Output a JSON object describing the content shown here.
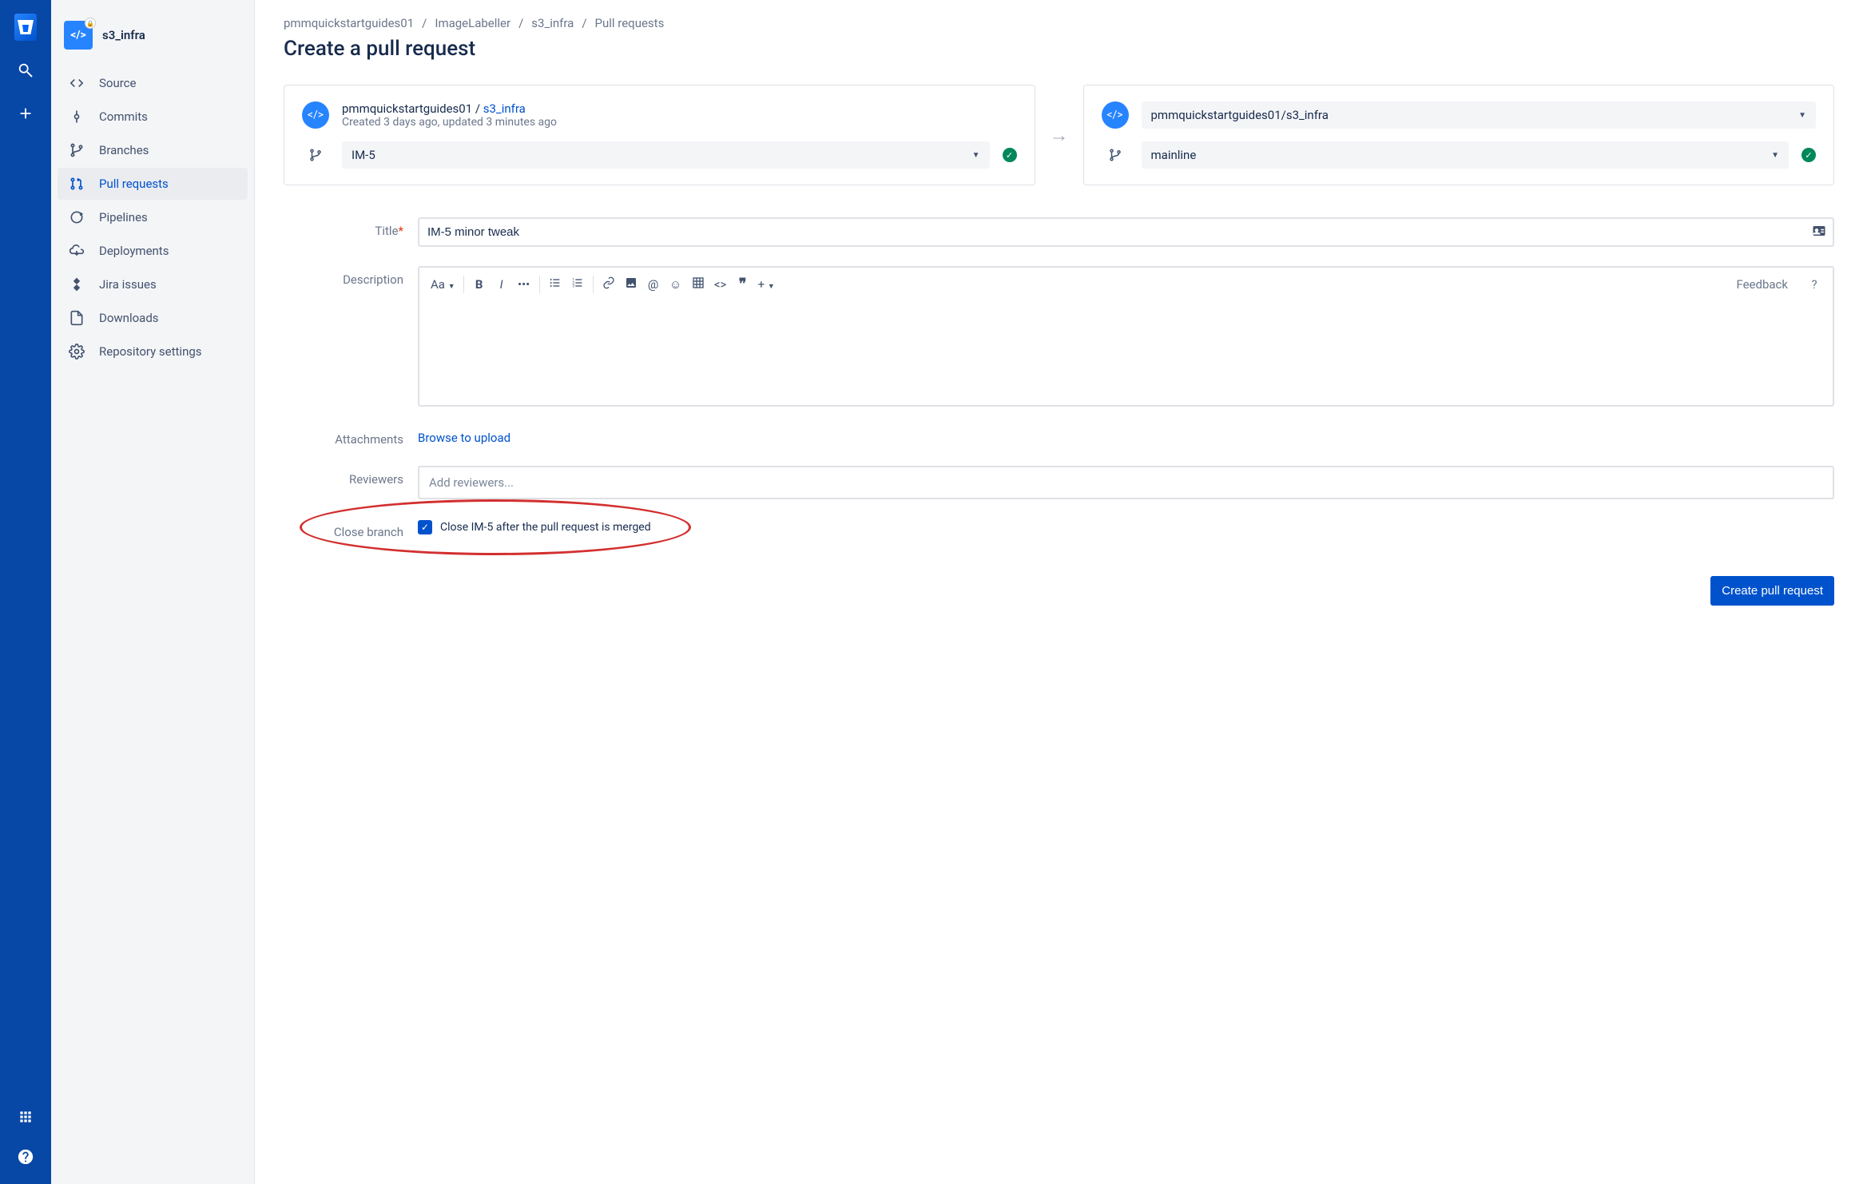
{
  "repo": {
    "name": "s3_infra"
  },
  "sidebar": {
    "items": [
      {
        "id": "source",
        "label": "Source"
      },
      {
        "id": "commits",
        "label": "Commits"
      },
      {
        "id": "branches",
        "label": "Branches"
      },
      {
        "id": "pull-requests",
        "label": "Pull requests"
      },
      {
        "id": "pipelines",
        "label": "Pipelines"
      },
      {
        "id": "deployments",
        "label": "Deployments"
      },
      {
        "id": "jira-issues",
        "label": "Jira issues"
      },
      {
        "id": "downloads",
        "label": "Downloads"
      },
      {
        "id": "repository-settings",
        "label": "Repository settings"
      }
    ]
  },
  "breadcrumb": {
    "p0": "pmmquickstartguides01",
    "p1": "ImageLabeller",
    "p2": "s3_infra",
    "p3": "Pull requests",
    "sep": "/"
  },
  "page": {
    "title": "Create a pull request"
  },
  "source_panel": {
    "workspace": "pmmquickstartguides01 / ",
    "repo": "s3_infra",
    "subtitle": "Created 3 days ago, updated 3 minutes ago",
    "branch": "IM-5"
  },
  "dest_panel": {
    "repo_full": "pmmquickstartguides01/s3_infra",
    "branch": "mainline"
  },
  "form": {
    "title_label": "Title",
    "title_value": "IM-5 minor tweak",
    "description_label": "Description",
    "attachments_label": "Attachments",
    "browse_label": "Browse to upload",
    "reviewers_label": "Reviewers",
    "reviewers_placeholder": "Add reviewers...",
    "close_branch_label": "Close branch",
    "close_branch_text": "Close IM-5 after the pull request is merged",
    "submit_label": "Create pull request"
  },
  "editor": {
    "text_style": "Aa",
    "feedback": "Feedback",
    "help": "?"
  }
}
